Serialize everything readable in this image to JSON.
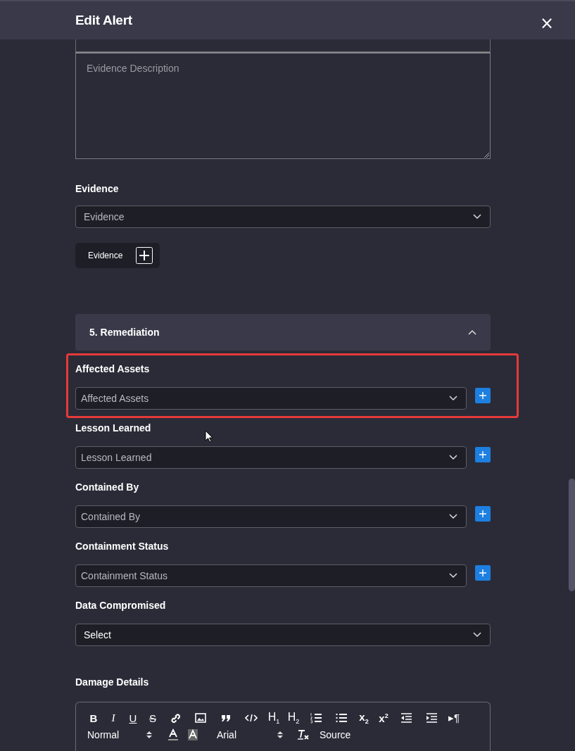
{
  "dialog": {
    "title": "Edit Alert",
    "close": "×"
  },
  "evidence_description": {
    "placeholder": "Evidence Description"
  },
  "evidence_field": {
    "label": "Evidence",
    "placeholder": "Evidence"
  },
  "evidence_button": {
    "label": "Evidence"
  },
  "section": {
    "title": "5. Remediation",
    "expanded": true
  },
  "fields": [
    {
      "label": "Affected Assets",
      "placeholder": "Affected Assets",
      "add_button": true,
      "highlighted": true
    },
    {
      "label": "Lesson Learned",
      "placeholder": "Lesson Learned",
      "add_button": true,
      "highlighted": false
    },
    {
      "label": "Contained By",
      "placeholder": "Contained By",
      "add_button": true,
      "highlighted": false
    },
    {
      "label": "Containment Status",
      "placeholder": "Containment Status",
      "add_button": true,
      "highlighted": false
    },
    {
      "label": "Data Compromised",
      "value": "Select",
      "add_button": false,
      "highlighted": false
    }
  ],
  "damage_details": {
    "label": "Damage Details",
    "toolbar": [
      "B",
      "I",
      "U",
      "S",
      "H$_{1}$",
      "H$_{2}$",
      "x$_{2}$",
      "x$^{2}$",
      "▸¶"
    ],
    "format": "Normal",
    "font": "Arial",
    "source": "Source"
  }
}
